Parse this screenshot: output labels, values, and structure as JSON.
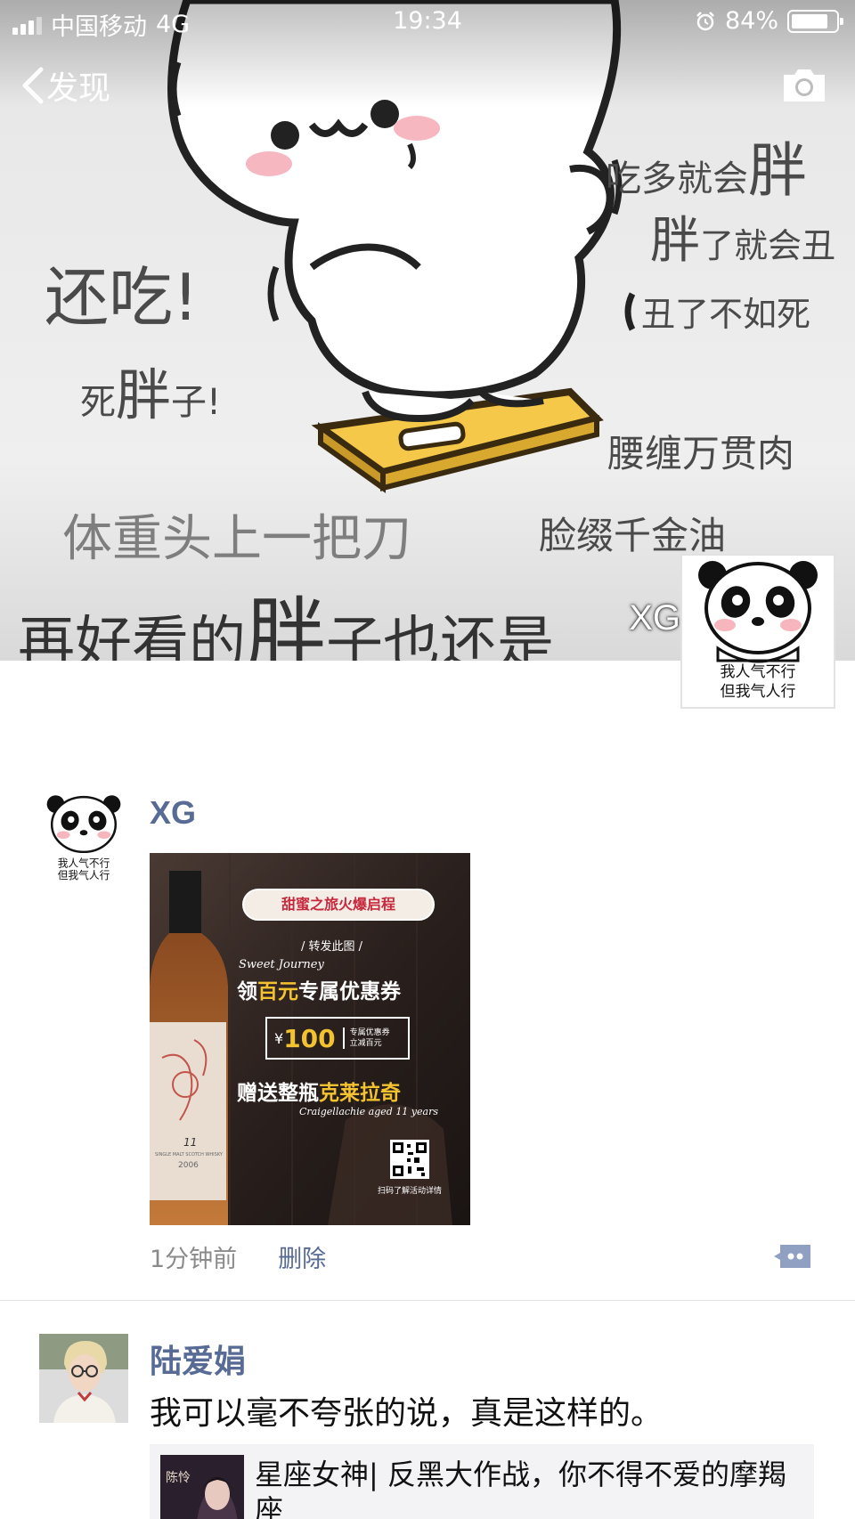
{
  "status_bar": {
    "carrier": "中国移动",
    "network": "4G",
    "time": "19:34",
    "battery_percent": "84%",
    "battery_level": 0.84
  },
  "nav": {
    "back_label": "发现",
    "back_icon": "chevron-left-icon",
    "camera_icon": "camera-icon"
  },
  "cover": {
    "lines": {
      "l1_pre": "吃多就会",
      "l1_big": "胖",
      "l2_big": "胖",
      "l2_post": "了就会丑",
      "l3": "还吃!",
      "l4": "丑了不如死",
      "l5_pre": "死",
      "l5_big": "胖",
      "l5_post": "子!",
      "l6": "腰缠万贯肉",
      "l7": "体重头上一把刀",
      "l8": "脸缀千金油",
      "l9_pre": "再好看的",
      "l9_big": "胖",
      "l9_post": "子也还是"
    },
    "owner_name": "XG",
    "avatar_caption_1": "我人气不行",
    "avatar_caption_2": "但我气人行"
  },
  "posts": [
    {
      "author": "XG",
      "avatar_caption_1": "我人气不行",
      "avatar_caption_2": "但我气人行",
      "image": {
        "banner": "甜蜜之旅火爆启程",
        "forward": "/ 转发此图 /",
        "script_title": "Sweet Journey",
        "headline_pre": "领",
        "headline_highlight": "百元",
        "headline_post": "专属优惠券",
        "coupon_symbol": "¥",
        "coupon_value": "100",
        "coupon_note_1": "专属优惠券",
        "coupon_note_2": "立减百元",
        "gift_pre": "赠送整瓶",
        "gift_highlight": "克莱拉奇",
        "gift_sub": "Craigellachie aged 11 years",
        "qr_caption": "扫码了解活动详情",
        "bottle_age": "11",
        "bottle_type": "SINGLE MALT SCOTCH WHISKY",
        "bottle_year": "2006"
      },
      "time": "1分钟前",
      "delete_label": "删除",
      "comment_icon": "comment-bubble-icon"
    },
    {
      "author": "陆爱娟",
      "text": "我可以毫不夸张的说，真是这样的。",
      "share": {
        "thumb_label": "陈怜",
        "title": "星座女神| 反黑大作战，你不得不爱的摩羯座"
      }
    }
  ],
  "colors": {
    "link_blue": "#576b95",
    "meta_gray": "#8a8a8a",
    "ad_gold": "#f2c230",
    "ad_red": "#c8283c"
  }
}
